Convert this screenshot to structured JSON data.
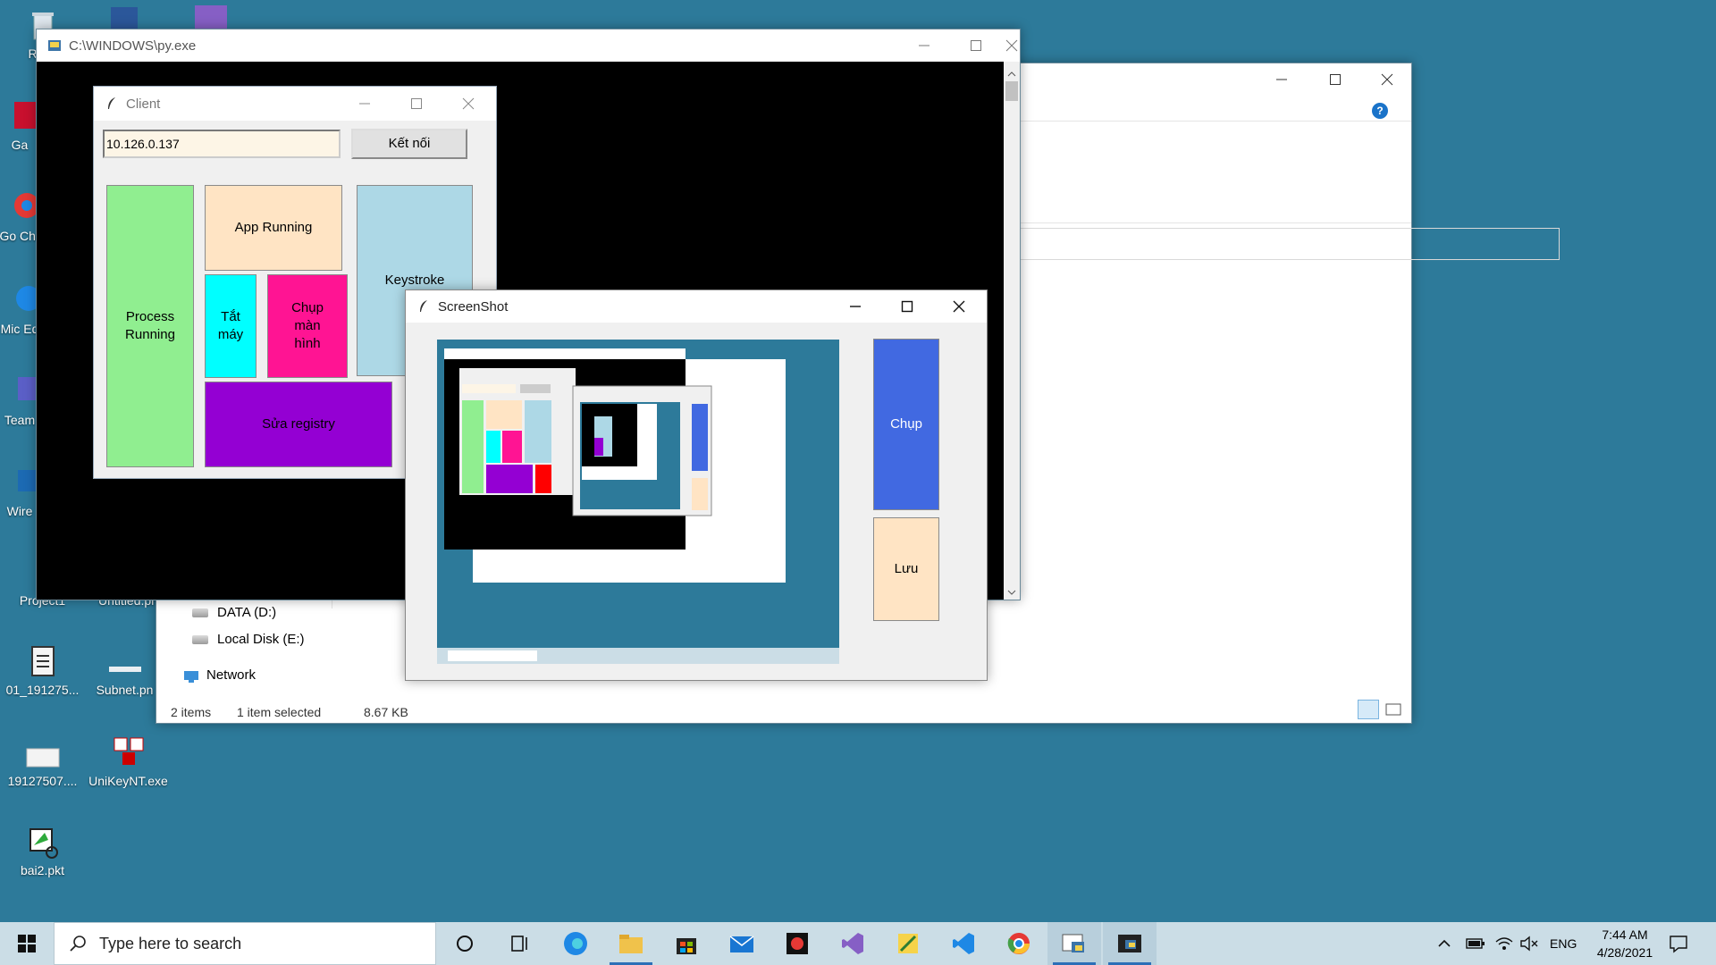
{
  "desktop": {
    "icons": [
      {
        "label": "Recy",
        "name": "recycle-bin-desktop-icon"
      },
      {
        "label": "Ga",
        "name": "game-desktop-icon"
      },
      {
        "label": "Go Chr",
        "name": "google-chrome-desktop-icon"
      },
      {
        "label": "Mic Ed",
        "name": "microsoft-edge-desktop-icon"
      },
      {
        "label": "Team",
        "name": "teams-desktop-icon"
      },
      {
        "label": "Wire",
        "name": "wireshark-desktop-icon"
      },
      {
        "label": "Project1",
        "name": "project1-folder-icon"
      },
      {
        "label": "Untitled.pn",
        "name": "untitled-png-icon"
      },
      {
        "label": "01_191275...",
        "name": "document-file-icon"
      },
      {
        "label": "Subnet.pn",
        "name": "subnet-png-icon"
      },
      {
        "label": "19127507....",
        "name": "image-file-icon"
      },
      {
        "label": "UniKeyNT.exe",
        "name": "unikey-exe-icon"
      },
      {
        "label": "bai2.pkt",
        "name": "packet-tracer-file-icon"
      }
    ]
  },
  "console_window": {
    "title": "C:\\WINDOWS\\py.exe"
  },
  "explorer": {
    "nav": [
      {
        "label": "DATA (D:)"
      },
      {
        "label": "Local Disk (E:)"
      },
      {
        "label": "Network"
      }
    ],
    "status": {
      "items": "2 items",
      "selected": "1 item selected",
      "size": "8.67 KB"
    }
  },
  "client_window": {
    "title": "Client",
    "ip_input_value": "10.126.0.137",
    "connect_label": "Kết nối",
    "buttons": {
      "process_running": "Process Running",
      "app_running": "App Running",
      "keystroke": "Keystroke",
      "shutdown": "Tắt máy",
      "screenshot": "Chụp màn hình",
      "registry": "Sửa registry"
    },
    "colors": {
      "process": "#90ee90",
      "app": "#ffe4c4",
      "keystroke": "#add8e6",
      "shutdown": "#00ffff",
      "screenshot": "#ff1493",
      "registry": "#9400d3"
    }
  },
  "screenshot_window": {
    "title": "ScreenShot",
    "capture_label": "Chụp",
    "save_label": "Lưu",
    "colors": {
      "capture": "#4169e1",
      "save": "#ffe4c4"
    }
  },
  "taskbar": {
    "search_placeholder": "Type here to search",
    "language": "ENG",
    "time": "7:44 AM",
    "date": "4/28/2021"
  }
}
